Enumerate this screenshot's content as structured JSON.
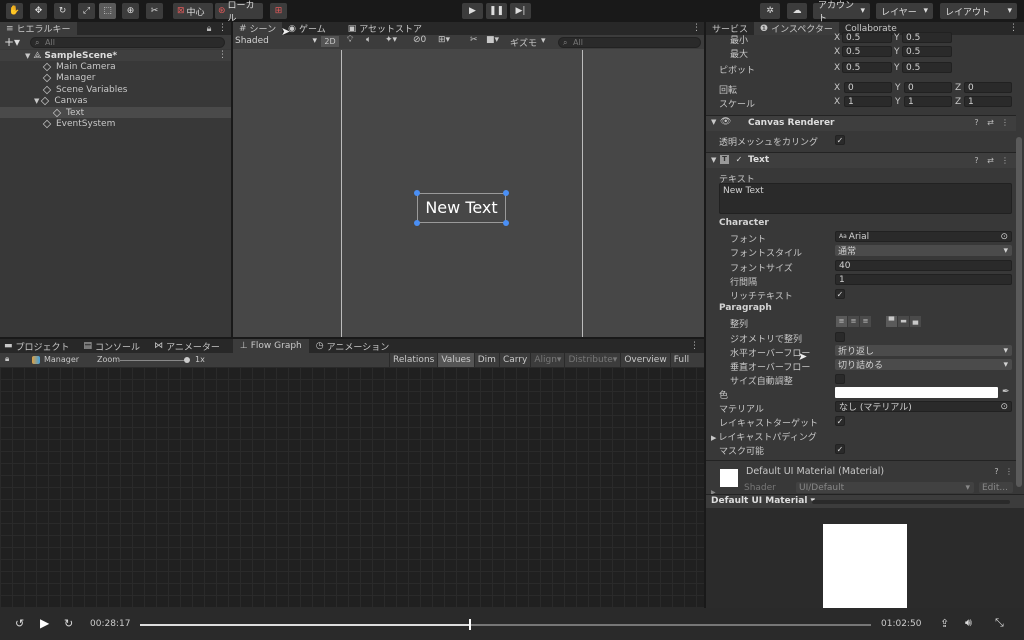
{
  "toolbar": {
    "pivot_label": "中心",
    "space_label": "ローカル",
    "account_label": "アカウント",
    "layers_label": "レイヤー",
    "layout_label": "レイアウト"
  },
  "hierarchy": {
    "tab": "ヒエラルキー",
    "search_placeholder": "All",
    "scene": "SampleScene*",
    "items": [
      {
        "label": "Main Camera"
      },
      {
        "label": "Manager"
      },
      {
        "label": "Scene Variables"
      },
      {
        "label": "Canvas"
      },
      {
        "label": "Text"
      },
      {
        "label": "EventSystem"
      }
    ]
  },
  "scene": {
    "tabs": [
      "シーン",
      "ゲーム",
      "アセットストア"
    ],
    "shading": "Shaded",
    "mode_2d": "2D",
    "hidden_count": "0",
    "gizmos": "ギズモ",
    "search_placeholder": "All",
    "object_text": "New Text"
  },
  "bottom": {
    "tabs": [
      "プロジェクト",
      "コンソール",
      "アニメーター",
      "Flow Graph",
      "アニメーション"
    ],
    "graph_name": "Manager",
    "zoom_label": "Zoom",
    "zoom_value": "1x",
    "buttons": [
      "Relations",
      "Values",
      "Dim",
      "Carry",
      "Align",
      "Distribute",
      "Overview",
      "Full Screen"
    ]
  },
  "inspector": {
    "tabs": [
      "サービス",
      "インスペクター",
      "Collaborate"
    ],
    "rect": {
      "min_label": "最小",
      "min_x": "0.5",
      "min_y": "0.5",
      "max_label": "最大",
      "max_x": "0.5",
      "max_y": "0.5",
      "pivot_label": "ピボット",
      "pivot_x": "0.5",
      "pivot_y": "0.5",
      "rotation_label": "回転",
      "rot_x": "0",
      "rot_y": "0",
      "rot_z": "0",
      "scale_label": "スケール",
      "scale_x": "1",
      "scale_y": "1",
      "scale_z": "1",
      "x": "X",
      "y": "Y",
      "z": "Z"
    },
    "canvas_renderer": {
      "title": "Canvas Renderer",
      "cull_label": "透明メッシュをカリング"
    },
    "text": {
      "title": "Text",
      "text_label": "テキスト",
      "text_value": "New Text",
      "character": "Character",
      "font_label": "フォント",
      "font_value": "Arial",
      "style_label": "フォントスタイル",
      "style_value": "通常",
      "size_label": "フォントサイズ",
      "size_value": "40",
      "line_label": "行間隔",
      "line_value": "1",
      "rich_label": "リッチテキスト",
      "paragraph": "Paragraph",
      "align_label": "整列",
      "geom_label": "ジオメトリで整列",
      "hover_label": "水平オーバーフロー",
      "hover_value": "折り返し",
      "vover_label": "垂直オーバーフロー",
      "vover_value": "切り詰める",
      "best_label": "サイズ自動調整",
      "color_label": "色",
      "color_value": "#ffffff",
      "material_label": "マテリアル",
      "material_value": "なし (マテリアル)",
      "raycast_label": "レイキャストターゲット",
      "padding_label": "レイキャストパディング",
      "mask_label": "マスク可能"
    },
    "material": {
      "title": "Default UI Material (Material)",
      "shader_label": "Shader",
      "shader_value": "UI/Default",
      "edit": "Edit...",
      "preview_title": "Default UI Material"
    }
  },
  "video": {
    "current": "00:28:17",
    "total": "01:02:50",
    "progress": 0.45
  }
}
